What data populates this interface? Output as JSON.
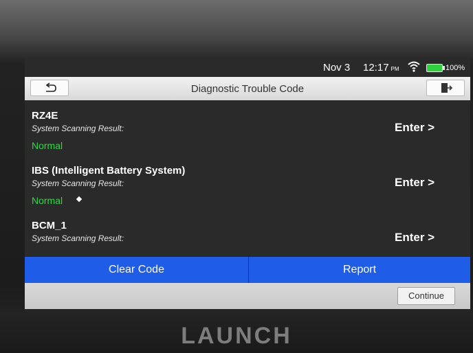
{
  "statusbar": {
    "date": "Nov 3",
    "time": "12:17",
    "ampm": "PM",
    "battery_level": 100,
    "battery_label": "100%",
    "wifi_icon": "wifi-icon",
    "battery_icon": "battery-icon"
  },
  "titlebar": {
    "title": "Diagnostic Trouble Code",
    "back_icon": "back-arrow-icon",
    "exit_icon": "exit-icon"
  },
  "list": {
    "items": [
      {
        "name": "RZ4E",
        "label": "System Scanning Result:",
        "status": "Normal",
        "enter": "Enter >"
      },
      {
        "name": "IBS (Intelligent Battery System)",
        "label": "System Scanning Result:",
        "status": "Normal",
        "enter": "Enter >"
      },
      {
        "name": "BCM_1",
        "label": "System Scanning Result:",
        "status": "",
        "enter": "Enter >"
      }
    ]
  },
  "actions": {
    "clear_code": "Clear Code",
    "report": "Report"
  },
  "footer": {
    "continue": "Continue"
  },
  "brand": {
    "name": "LAUNCH"
  },
  "colors": {
    "accent": "#1f5ce8",
    "status_ok": "#33d64a",
    "titlebar": "#e5e5e5"
  }
}
